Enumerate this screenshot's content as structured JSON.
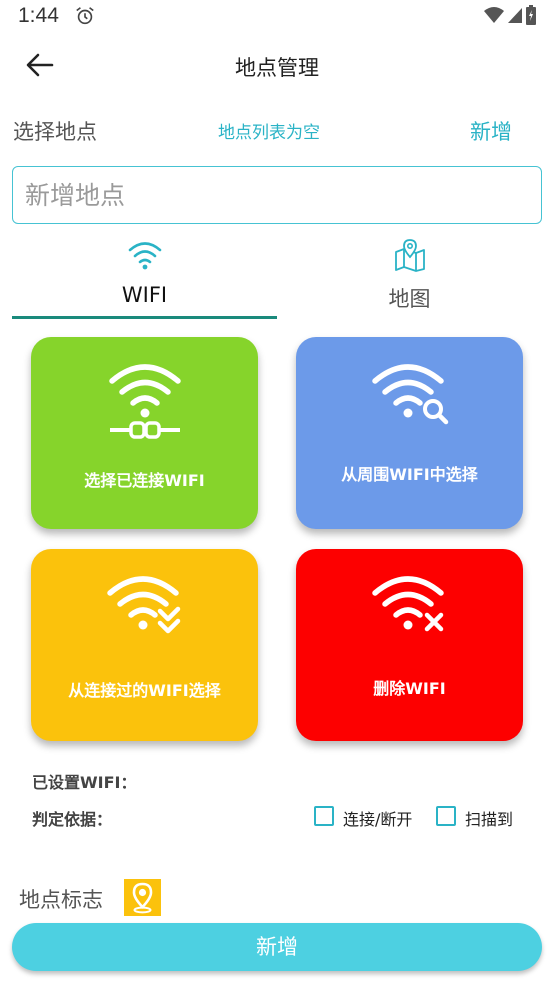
{
  "status_bar": {
    "time": "1:44",
    "icons": [
      "alarm-icon",
      "wifi-signal-icon",
      "cell-signal-icon",
      "battery-icon"
    ]
  },
  "header": {
    "title": "地点管理",
    "back_icon": "arrow-left-icon"
  },
  "location_select": {
    "label": "选择地点",
    "empty_text": "地点列表为空",
    "add_label": "新增"
  },
  "name_input": {
    "placeholder": "新增地点",
    "value": ""
  },
  "tabs": [
    {
      "label": "WIFI",
      "icon": "wifi-icon",
      "active": true
    },
    {
      "label": "地图",
      "icon": "map-icon",
      "active": false
    }
  ],
  "actions": [
    {
      "label": "选择已连接WIFI",
      "icon": "wifi-connected-icon",
      "color": "#86d42b"
    },
    {
      "label": "从周围WIFI中选择",
      "icon": "wifi-search-icon",
      "color": "#6c9ae9"
    },
    {
      "label": "从连接过的WIFI选择",
      "icon": "wifi-check-icon",
      "color": "#fbc20c"
    },
    {
      "label": "删除WIFI",
      "icon": "wifi-delete-icon",
      "color": "#fd0000"
    }
  ],
  "wifi_info": {
    "set_label": "已设置WIFI：",
    "judge_label": "判定依据："
  },
  "criteria": [
    {
      "label": "连接/断开",
      "checked": false
    },
    {
      "label": "扫描到",
      "checked": false
    }
  ],
  "marker": {
    "label": "地点标志",
    "icon": "map-pin-icon",
    "color": "#fbc20c"
  },
  "submit_label": "新增",
  "colors": {
    "accent": "#2ab3c6",
    "tab_indicator": "#1a8a7c",
    "button": "#4dd0e1"
  }
}
